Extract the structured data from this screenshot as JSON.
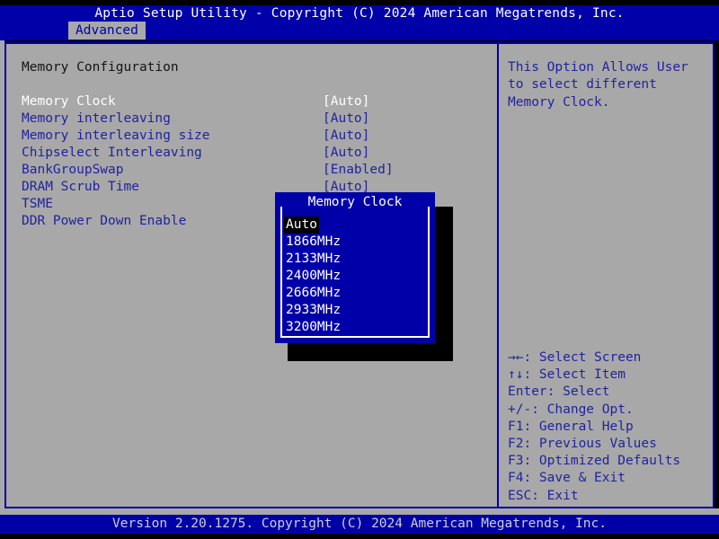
{
  "header": {
    "title": "Aptio Setup Utility - Copyright (C) 2024 American Megatrends, Inc.",
    "tab_label": "Advanced"
  },
  "main": {
    "section_title": "Memory Configuration",
    "options": [
      {
        "label": "Memory Clock",
        "value": "[Auto]",
        "selected": true
      },
      {
        "label": "Memory interleaving",
        "value": "[Auto]",
        "selected": false
      },
      {
        "label": "Memory interleaving size",
        "value": "[Auto]",
        "selected": false
      },
      {
        "label": "Chipselect Interleaving",
        "value": "[Auto]",
        "selected": false
      },
      {
        "label": "BankGroupSwap",
        "value": "[Enabled]",
        "selected": false
      },
      {
        "label": "DRAM Scrub Time",
        "value": "[Auto]",
        "selected": false
      },
      {
        "label": "TSME",
        "value": "",
        "selected": false
      },
      {
        "label": "DDR Power Down Enable",
        "value": "",
        "selected": false
      }
    ]
  },
  "popup": {
    "title": "Memory Clock",
    "items": [
      {
        "label": "Auto",
        "selected": true
      },
      {
        "label": "1866MHz",
        "selected": false
      },
      {
        "label": "2133MHz",
        "selected": false
      },
      {
        "label": "2400MHz",
        "selected": false
      },
      {
        "label": "2666MHz",
        "selected": false
      },
      {
        "label": "2933MHz",
        "selected": false
      },
      {
        "label": "3200MHz",
        "selected": false
      }
    ]
  },
  "help": {
    "text": "This Option Allows User to select different Memory Clock.",
    "legend": [
      "→←: Select Screen",
      "↑↓: Select Item",
      "Enter: Select",
      "+/-: Change Opt.",
      "F1: General Help",
      "F2: Previous Values",
      "F3: Optimized Defaults",
      "F4: Save & Exit",
      "ESC: Exit"
    ]
  },
  "footer": {
    "text": "Version 2.20.1275. Copyright (C) 2024 American Megatrends, Inc."
  },
  "colors": {
    "bios_blue": "#0000a8",
    "panel_gray": "#a8a8a8",
    "text_blue": "#2222a0",
    "text_white": "#ffffff",
    "black": "#000000"
  }
}
